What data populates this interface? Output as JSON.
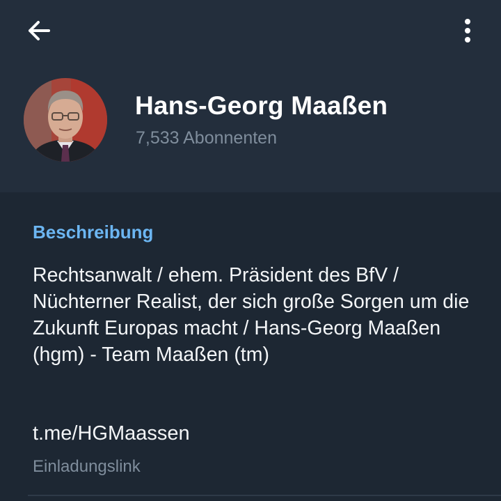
{
  "header": {
    "back_icon": "arrow-left-icon",
    "menu_icon": "more-vertical-icon",
    "title": "Hans-Georg Maaßen",
    "subscribers": "7,533 Abonnenten"
  },
  "info": {
    "heading": "Beschreibung",
    "description": "Rechtsanwalt / ehem. Präsident des BfV / Nüchterner Realist, der sich große Sorgen um die Zukunft Europas macht / Hans-Georg Maaßen (hgm) - Team Maaßen (tm)",
    "link": "t.me/HGMaassen",
    "link_caption": "Einladungslink"
  },
  "colors": {
    "header_bg": "#232e3c",
    "body_bg": "#1d2733",
    "accent": "#6cb6f2",
    "secondary_text": "#7f8d9c"
  }
}
